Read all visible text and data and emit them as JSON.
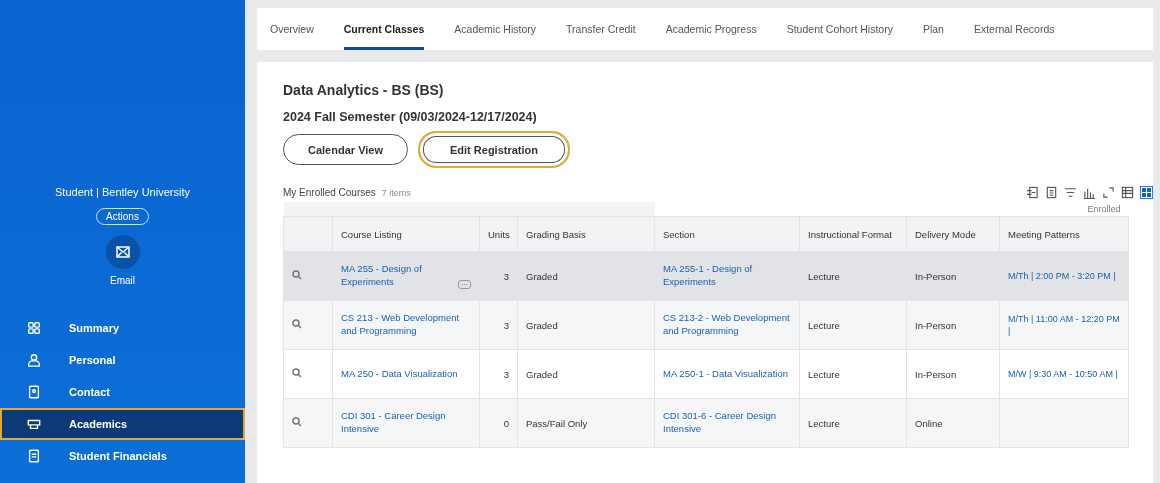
{
  "sidebar": {
    "subtitle": "Student | Bentley University",
    "actions_button": "Actions",
    "email_label": "Email",
    "items": [
      {
        "label": "Summary",
        "kind": "grid",
        "selected": false
      },
      {
        "label": "Personal",
        "kind": "person",
        "selected": false
      },
      {
        "label": "Contact",
        "kind": "contact",
        "selected": false
      },
      {
        "label": "Academics",
        "kind": "cap",
        "selected": true
      },
      {
        "label": "Student Financials",
        "kind": "doc",
        "selected": false
      }
    ]
  },
  "tabs": [
    {
      "label": "Overview",
      "selected": false
    },
    {
      "label": "Current Classes",
      "selected": true
    },
    {
      "label": "Academic History",
      "selected": false
    },
    {
      "label": "Transfer Credit",
      "selected": false
    },
    {
      "label": "Academic Progress",
      "selected": false
    },
    {
      "label": "Student Cohort History",
      "selected": false
    },
    {
      "label": "Plan",
      "selected": false
    },
    {
      "label": "External Records",
      "selected": false
    }
  ],
  "program_title": "Data Analytics - BS (BS)",
  "semester_title": "2024 Fall Semester (09/03/2024-12/17/2024)",
  "buttons": [
    {
      "label": "Calendar View",
      "focused": false
    },
    {
      "label": "Edit Registration",
      "focused": true
    }
  ],
  "table": {
    "title": "My Enrolled Courses",
    "count": "7 items",
    "group_header": "Enrolled",
    "columns": [
      "Course Listing",
      "Units",
      "Grading Basis",
      "Section",
      "Instructional Format",
      "Delivery Mode",
      "Meeting Patterns"
    ],
    "rows": [
      {
        "hovered": true,
        "course": "MA 255 - Design of Experiments",
        "more": "···",
        "units": "3",
        "grading": "Graded",
        "section": "MA 255-1 - Design of Experiments",
        "format": "Lecture",
        "delivery": "In-Person",
        "meeting": "M/Th | 2:00 PM - 3:20 PM |"
      },
      {
        "hovered": false,
        "course": "CS 213 - Web Development and Programming",
        "units": "3",
        "grading": "Graded",
        "section": "CS 213-2 - Web Development and Programming",
        "format": "Lecture",
        "delivery": "In-Person",
        "meeting": "M/Th | 11:00 AM - 12:20 PM |"
      },
      {
        "hovered": false,
        "course": "MA 250 - Data Visualization",
        "units": "3",
        "grading": "Graded",
        "section": "MA 250-1 - Data Visualization",
        "format": "Lecture",
        "delivery": "In-Person",
        "meeting": "M/W | 9:30 AM - 10:50 AM |"
      },
      {
        "hovered": false,
        "course": "CDI 301 - Career Design Intensive",
        "units": "0",
        "grading": "Pass/Fail Only",
        "section": "CDI 301-6 - Career Design Intensive",
        "format": "Lecture",
        "delivery": "Online"
      }
    ]
  }
}
